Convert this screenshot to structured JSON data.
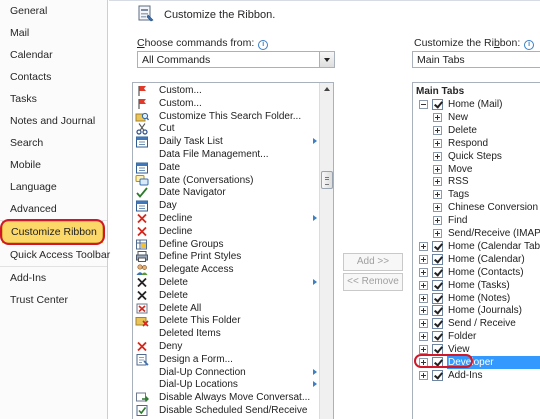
{
  "nav": {
    "items": [
      "General",
      "Mail",
      "Calendar",
      "Contacts",
      "Tasks",
      "Notes and Journal",
      "Search",
      "Mobile",
      "Language",
      "Advanced",
      "Customize Ribbon",
      "Quick Access Toolbar",
      "Add-Ins",
      "Trust Center"
    ],
    "selected": "Customize Ribbon"
  },
  "header": {
    "title": "Customize the Ribbon.",
    "icon": "customize-ribbon-icon"
  },
  "left_panel": {
    "label_prefix": "C",
    "label_rest": "hoose commands from:",
    "dropdown_value": "All Commands",
    "commands": [
      {
        "label": "Custom...",
        "icon": "flag-icon",
        "submenu": false
      },
      {
        "label": "Custom...",
        "icon": "flag-icon",
        "submenu": false
      },
      {
        "label": "Customize This Search Folder...",
        "icon": "search-folder-icon",
        "submenu": false
      },
      {
        "label": "Cut",
        "icon": "scissors-icon",
        "submenu": false
      },
      {
        "label": "Daily Task List",
        "icon": "calendar-icon",
        "submenu": true
      },
      {
        "label": "Data File Management...",
        "icon": "",
        "submenu": false
      },
      {
        "label": "Date",
        "icon": "calendar-icon",
        "submenu": false
      },
      {
        "label": "Date (Conversations)",
        "icon": "conversation-icon",
        "submenu": false
      },
      {
        "label": "Date Navigator",
        "icon": "check-icon",
        "submenu": false
      },
      {
        "label": "Day",
        "icon": "calendar-icon",
        "submenu": false
      },
      {
        "label": "Decline",
        "icon": "red-x-icon",
        "submenu": true
      },
      {
        "label": "Decline",
        "icon": "red-x-icon",
        "submenu": false
      },
      {
        "label": "Define Groups",
        "icon": "groups-icon",
        "submenu": false
      },
      {
        "label": "Define Print Styles",
        "icon": "print-icon",
        "submenu": false
      },
      {
        "label": "Delegate Access",
        "icon": "people-icon",
        "submenu": false
      },
      {
        "label": "Delete",
        "icon": "black-x-icon",
        "submenu": true
      },
      {
        "label": "Delete",
        "icon": "black-x-icon",
        "submenu": false
      },
      {
        "label": "Delete All",
        "icon": "delete-all-icon",
        "submenu": false
      },
      {
        "label": "Delete This Folder",
        "icon": "delete-folder-icon",
        "submenu": false
      },
      {
        "label": "Deleted Items",
        "icon": "",
        "submenu": false
      },
      {
        "label": "Deny",
        "icon": "red-x-icon",
        "submenu": false
      },
      {
        "label": "Design a Form...",
        "icon": "form-icon",
        "submenu": false
      },
      {
        "label": "Dial-Up Connection",
        "icon": "",
        "submenu": true
      },
      {
        "label": "Dial-Up Locations",
        "icon": "",
        "submenu": true
      },
      {
        "label": "Disable Always Move Conversat...",
        "icon": "move-icon",
        "submenu": false
      },
      {
        "label": "Disable Scheduled Send/Receive",
        "icon": "checkbox-icon",
        "submenu": false
      }
    ]
  },
  "middle": {
    "add": "Add >>",
    "remove": "<< Remove"
  },
  "right_panel": {
    "label_prefix": "Customize the Ri",
    "label_underlined": "b",
    "label_suffix": "bon:",
    "dropdown_value": "Main Tabs",
    "tree_heading": "Main Tabs",
    "tree": [
      {
        "label": "Home (Mail)",
        "level": 0,
        "expander": "minus",
        "checked": true
      },
      {
        "label": "New",
        "level": 1,
        "expander": "plus",
        "checked": false
      },
      {
        "label": "Delete",
        "level": 1,
        "expander": "plus",
        "checked": false
      },
      {
        "label": "Respond",
        "level": 1,
        "expander": "plus",
        "checked": false
      },
      {
        "label": "Quick Steps",
        "level": 1,
        "expander": "plus",
        "checked": false
      },
      {
        "label": "Move",
        "level": 1,
        "expander": "plus",
        "checked": false
      },
      {
        "label": "RSS",
        "level": 1,
        "expander": "plus",
        "checked": false
      },
      {
        "label": "Tags",
        "level": 1,
        "expander": "plus",
        "checked": false
      },
      {
        "label": "Chinese Conversion",
        "level": 1,
        "expander": "plus",
        "checked": false
      },
      {
        "label": "Find",
        "level": 1,
        "expander": "plus",
        "checked": false
      },
      {
        "label": "Send/Receive (IMAP/...",
        "level": 1,
        "expander": "plus",
        "checked": false
      },
      {
        "label": "Home (Calendar Table V...",
        "level": 0,
        "expander": "plus",
        "checked": true
      },
      {
        "label": "Home (Calendar)",
        "level": 0,
        "expander": "plus",
        "checked": true
      },
      {
        "label": "Home (Contacts)",
        "level": 0,
        "expander": "plus",
        "checked": true
      },
      {
        "label": "Home (Tasks)",
        "level": 0,
        "expander": "plus",
        "checked": true
      },
      {
        "label": "Home (Notes)",
        "level": 0,
        "expander": "plus",
        "checked": true
      },
      {
        "label": "Home (Journals)",
        "level": 0,
        "expander": "plus",
        "checked": true
      },
      {
        "label": "Send / Receive",
        "level": 0,
        "expander": "plus",
        "checked": true
      },
      {
        "label": "Folder",
        "level": 0,
        "expander": "plus",
        "checked": true
      },
      {
        "label": "View",
        "level": 0,
        "expander": "plus",
        "checked": true
      },
      {
        "label": "Developer",
        "level": 0,
        "expander": "plus",
        "checked": true,
        "selected": true
      },
      {
        "label": "Add-Ins",
        "level": 0,
        "expander": "plus",
        "checked": true
      }
    ]
  },
  "colors": {
    "nav_selected": "#fbd868",
    "highlight_ring": "#d0182a",
    "tree_selected": "#3399ff",
    "info_icon": "#3c7fc4"
  }
}
